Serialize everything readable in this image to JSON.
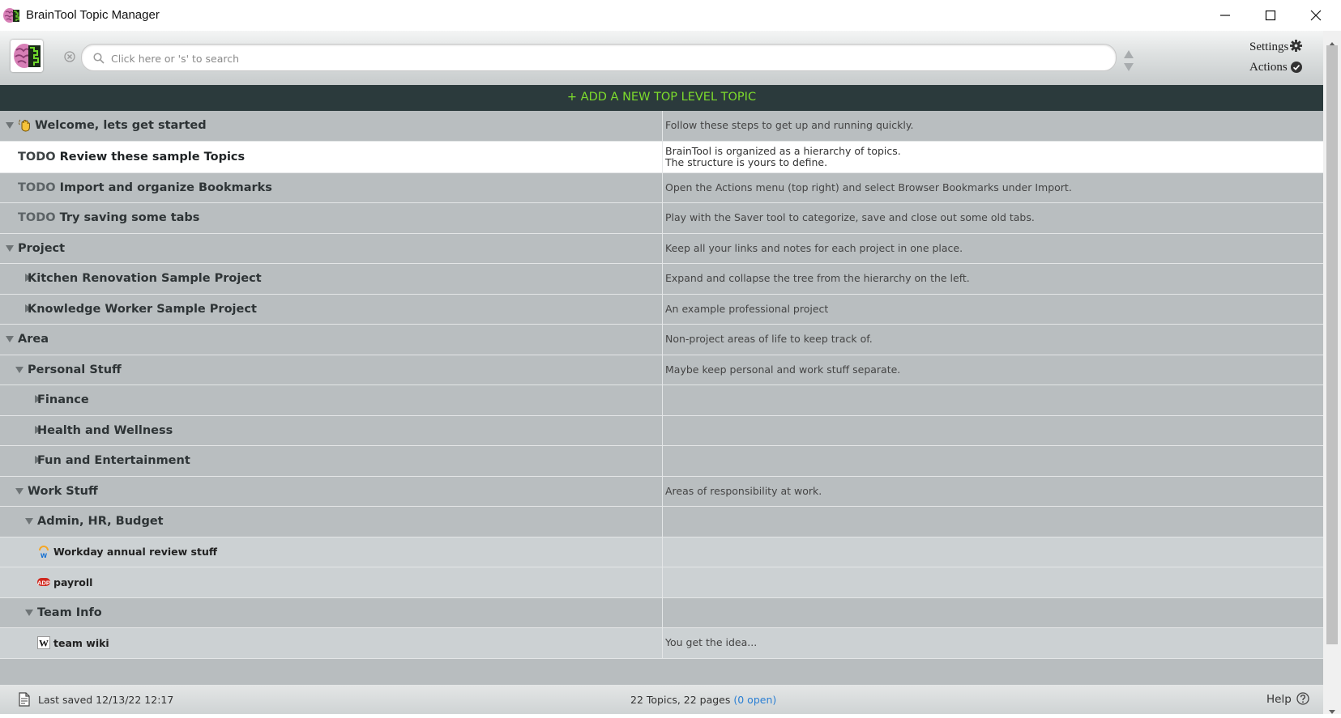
{
  "window": {
    "title": "BrainTool Topic Manager"
  },
  "header": {
    "search_placeholder": "Click here or 's' to search",
    "settings_label": "Settings",
    "actions_label": "Actions"
  },
  "add_topic_label": "+ ADD A NEW TOP LEVEL TOPIC",
  "rows": [
    {
      "title": "Welcome, lets get started",
      "todo": "",
      "note": [
        "Follow these steps to get up and running quickly."
      ],
      "depth": 0,
      "expander": "open",
      "kind": "topic",
      "icon": "wave-icon"
    },
    {
      "title": "Review these sample Topics",
      "todo": "TODO",
      "note": [
        "BrainTool is organized as a hierarchy of topics.",
        "The structure is yours to define."
      ],
      "depth": 0,
      "expander": "none",
      "kind": "selected"
    },
    {
      "title": "Import and organize Bookmarks",
      "todo": "TODO",
      "note": [
        "Open the Actions menu (top right) and select Browser Bookmarks under Import."
      ],
      "depth": 0,
      "expander": "none",
      "kind": "topic"
    },
    {
      "title": "Try saving some tabs",
      "todo": "TODO",
      "note": [
        "Play with the Saver tool to categorize, save and close out some old tabs."
      ],
      "depth": 0,
      "expander": "none",
      "kind": "topic"
    },
    {
      "title": "Project",
      "todo": "",
      "note": [
        "Keep all your links and notes for each project in one place."
      ],
      "depth": 0,
      "expander": "open",
      "kind": "topic"
    },
    {
      "title": "Kitchen Renovation Sample Project",
      "todo": "",
      "note": [
        "Expand and collapse the tree from the hierarchy on the left."
      ],
      "depth": 1,
      "expander": "closed",
      "kind": "topic"
    },
    {
      "title": "Knowledge Worker Sample Project",
      "todo": "",
      "note": [
        "An example professional project"
      ],
      "depth": 1,
      "expander": "closed",
      "kind": "topic"
    },
    {
      "title": "Area",
      "todo": "",
      "note": [
        "Non-project areas of life to keep track of."
      ],
      "depth": 0,
      "expander": "open",
      "kind": "topic"
    },
    {
      "title": "Personal Stuff",
      "todo": "",
      "note": [
        "Maybe keep personal and work stuff separate."
      ],
      "depth": 1,
      "expander": "open",
      "kind": "topic"
    },
    {
      "title": "Finance",
      "todo": "",
      "note": [],
      "depth": 2,
      "expander": "closed",
      "kind": "topic"
    },
    {
      "title": "Health and Wellness",
      "todo": "",
      "note": [],
      "depth": 2,
      "expander": "closed",
      "kind": "topic"
    },
    {
      "title": "Fun and Entertainment",
      "todo": "",
      "note": [],
      "depth": 2,
      "expander": "closed",
      "kind": "topic"
    },
    {
      "title": "Work Stuff",
      "todo": "",
      "note": [
        "Areas of responsibility at work."
      ],
      "depth": 1,
      "expander": "open",
      "kind": "topic"
    },
    {
      "title": "Admin, HR, Budget",
      "todo": "",
      "note": [],
      "depth": 2,
      "expander": "open",
      "kind": "topic"
    },
    {
      "title": "Workday annual review stuff",
      "todo": "",
      "note": [],
      "depth": 3,
      "expander": "none",
      "kind": "link",
      "icon": "workday-icon"
    },
    {
      "title": "payroll",
      "todo": "",
      "note": [],
      "depth": 3,
      "expander": "none",
      "kind": "link",
      "icon": "adp-icon"
    },
    {
      "title": "Team Info",
      "todo": "",
      "note": [],
      "depth": 2,
      "expander": "open",
      "kind": "topic"
    },
    {
      "title": "team wiki",
      "todo": "",
      "note": [
        "You get the idea..."
      ],
      "depth": 3,
      "expander": "none",
      "kind": "link",
      "icon": "wikipedia-icon"
    }
  ],
  "status": {
    "last_saved": "Last saved 12/13/22 12:17",
    "topic_count": "22 Topics, 22 pages",
    "open_count": "(0 open)",
    "help_label": "Help"
  },
  "colors": {
    "add_bar_bg": "#2b3a3c",
    "add_bar_text": "#7ddc2c",
    "topic_row": "#b9bec0",
    "link_row": "#ccd1d3",
    "open_link": "#2a7fd4"
  }
}
